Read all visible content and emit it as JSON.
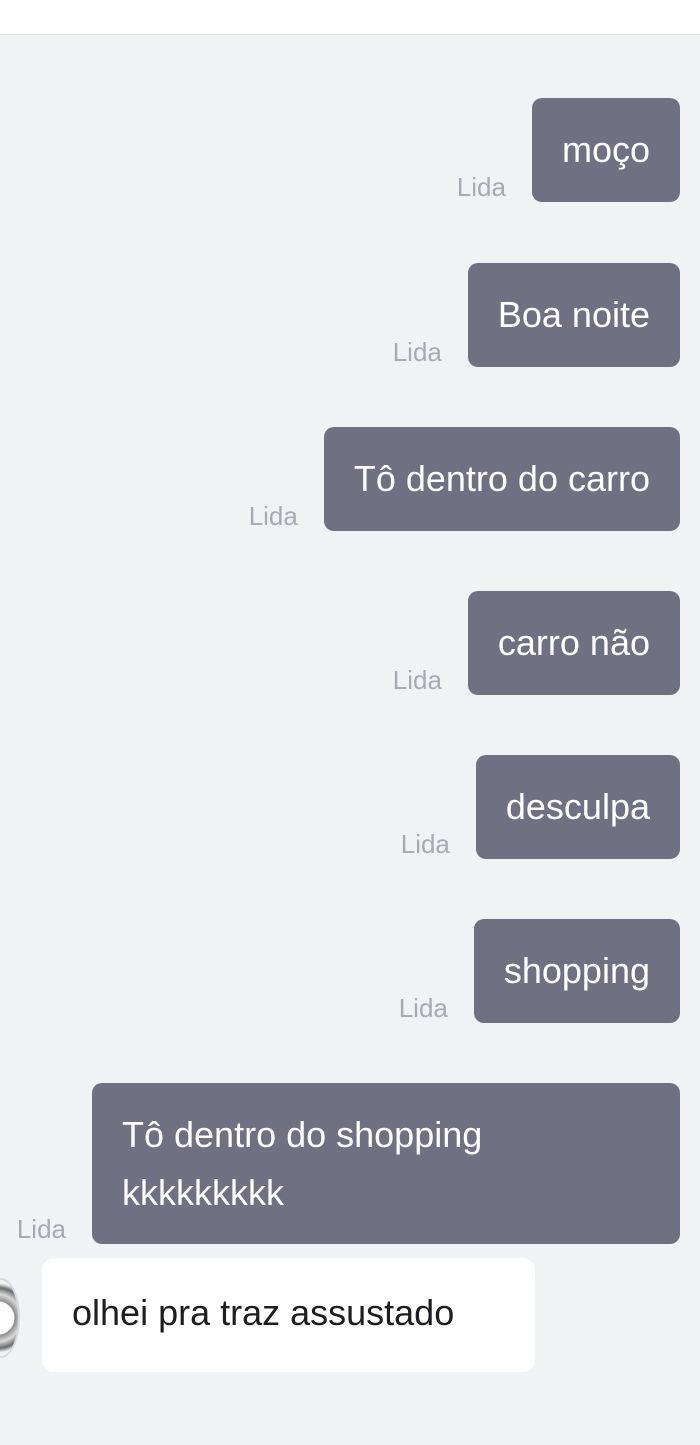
{
  "read_label": "Lida",
  "messages_out": [
    {
      "text": "moço"
    },
    {
      "text": "Boa noite"
    },
    {
      "text": "Tô dentro do carro"
    },
    {
      "text": "carro não"
    },
    {
      "text": "desculpa"
    },
    {
      "text": "shopping"
    },
    {
      "line1": "Tô dentro do shopping",
      "line2": "kkkkkkkkk"
    }
  ],
  "message_in": {
    "text": "olhei pra traz assustado"
  },
  "colors": {
    "outgoing_bubble": "#6f7183",
    "incoming_bubble": "#ffffff",
    "background": "#f1f2f4",
    "read_label": "#a7aab2"
  }
}
